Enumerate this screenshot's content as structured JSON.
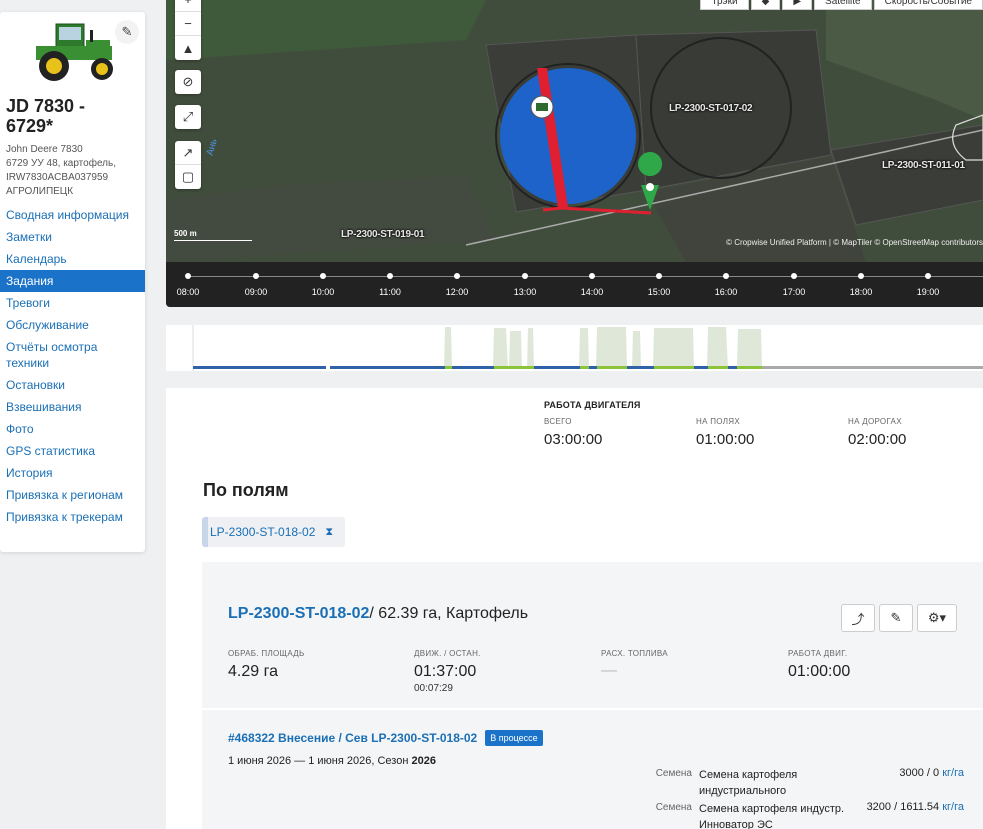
{
  "vehicle": {
    "title": "JD 7830 - 6729*",
    "model": "John Deere 7830",
    "plate_info": "6729 УУ 48, картофель,",
    "serial": "IRW7830ACBA037959",
    "company": "АГРОЛИПЕЦК"
  },
  "nav": {
    "items": [
      {
        "label": "Сводная информация"
      },
      {
        "label": "Заметки"
      },
      {
        "label": "Календарь"
      },
      {
        "label": "Задания",
        "active": true
      },
      {
        "label": "Тревоги"
      },
      {
        "label": "Обслуживание"
      },
      {
        "label": "Отчёты осмотра техники"
      },
      {
        "label": "Остановки"
      },
      {
        "label": "Взвешивания"
      },
      {
        "label": "Фото"
      },
      {
        "label": "GPS статистика"
      },
      {
        "label": "История"
      },
      {
        "label": "Привязка к регионам"
      },
      {
        "label": "Привязка к трекерам"
      }
    ]
  },
  "map": {
    "top_buttons": [
      "Трэки",
      "◆",
      "▶",
      "Satellite",
      "Скорость/Событие"
    ],
    "scale_label": "500 m",
    "attribution": "© Cropwise Unified Platform | © MapTiler © OpenStreetMap contributors",
    "fields": [
      "LP-2300-ST-017-02",
      "LP-2300-ST-011-01",
      "LP-2300-ST-019-01"
    ],
    "water_label": "Ань",
    "timeline": [
      "08:00",
      "09:00",
      "10:00",
      "11:00",
      "12:00",
      "13:00",
      "14:00",
      "15:00",
      "16:00",
      "17:00",
      "18:00",
      "19:00"
    ]
  },
  "engine": {
    "heading": "РАБОТА ДВИГАТЕЛЯ",
    "total_label": "ВСЕГО",
    "total": "03:00:00",
    "fields_label": "НА ПОЛЯХ",
    "fields": "01:00:00",
    "roads_label": "НА ДОРОГАХ",
    "roads": "02:00:00"
  },
  "by_fields": {
    "title": "По полям",
    "chip_label": "LP-2300-ST-018-02",
    "chip_icon": "hourglass-icon"
  },
  "field_panel": {
    "field_link": "LP-2300-ST-018-02",
    "field_info": "/ 62.39 га, Картофель",
    "area_label": "ОБРАБ. ПЛОЩАДЬ",
    "area": "4.29 га",
    "move_label": "ДВИЖ. / ОСТАН.",
    "move": "01:37:00",
    "stop": "00:07:29",
    "fuel_label": "РАСХ. ТОПЛИВА",
    "fuel": "—",
    "engine_label": "РАБОТА ДВИГ.",
    "engine": "01:00:00"
  },
  "task": {
    "link": "#468322 Внесение / Сев LP-2300-ST-018-02",
    "status": "В процессе",
    "dates": "1 июня 2026 — 1 июня 2026, Сезон ",
    "season": "2026",
    "seeds": [
      {
        "type": "Семена",
        "name": "Семена картофеля индустриального",
        "amount": "3000 / 0",
        "unit": "кг/га"
      },
      {
        "type": "Семена",
        "name": "Семена картофеля индустр. Инноватор ЭС",
        "amount": "3200 / 1611.54",
        "unit": "кг/га"
      }
    ]
  }
}
